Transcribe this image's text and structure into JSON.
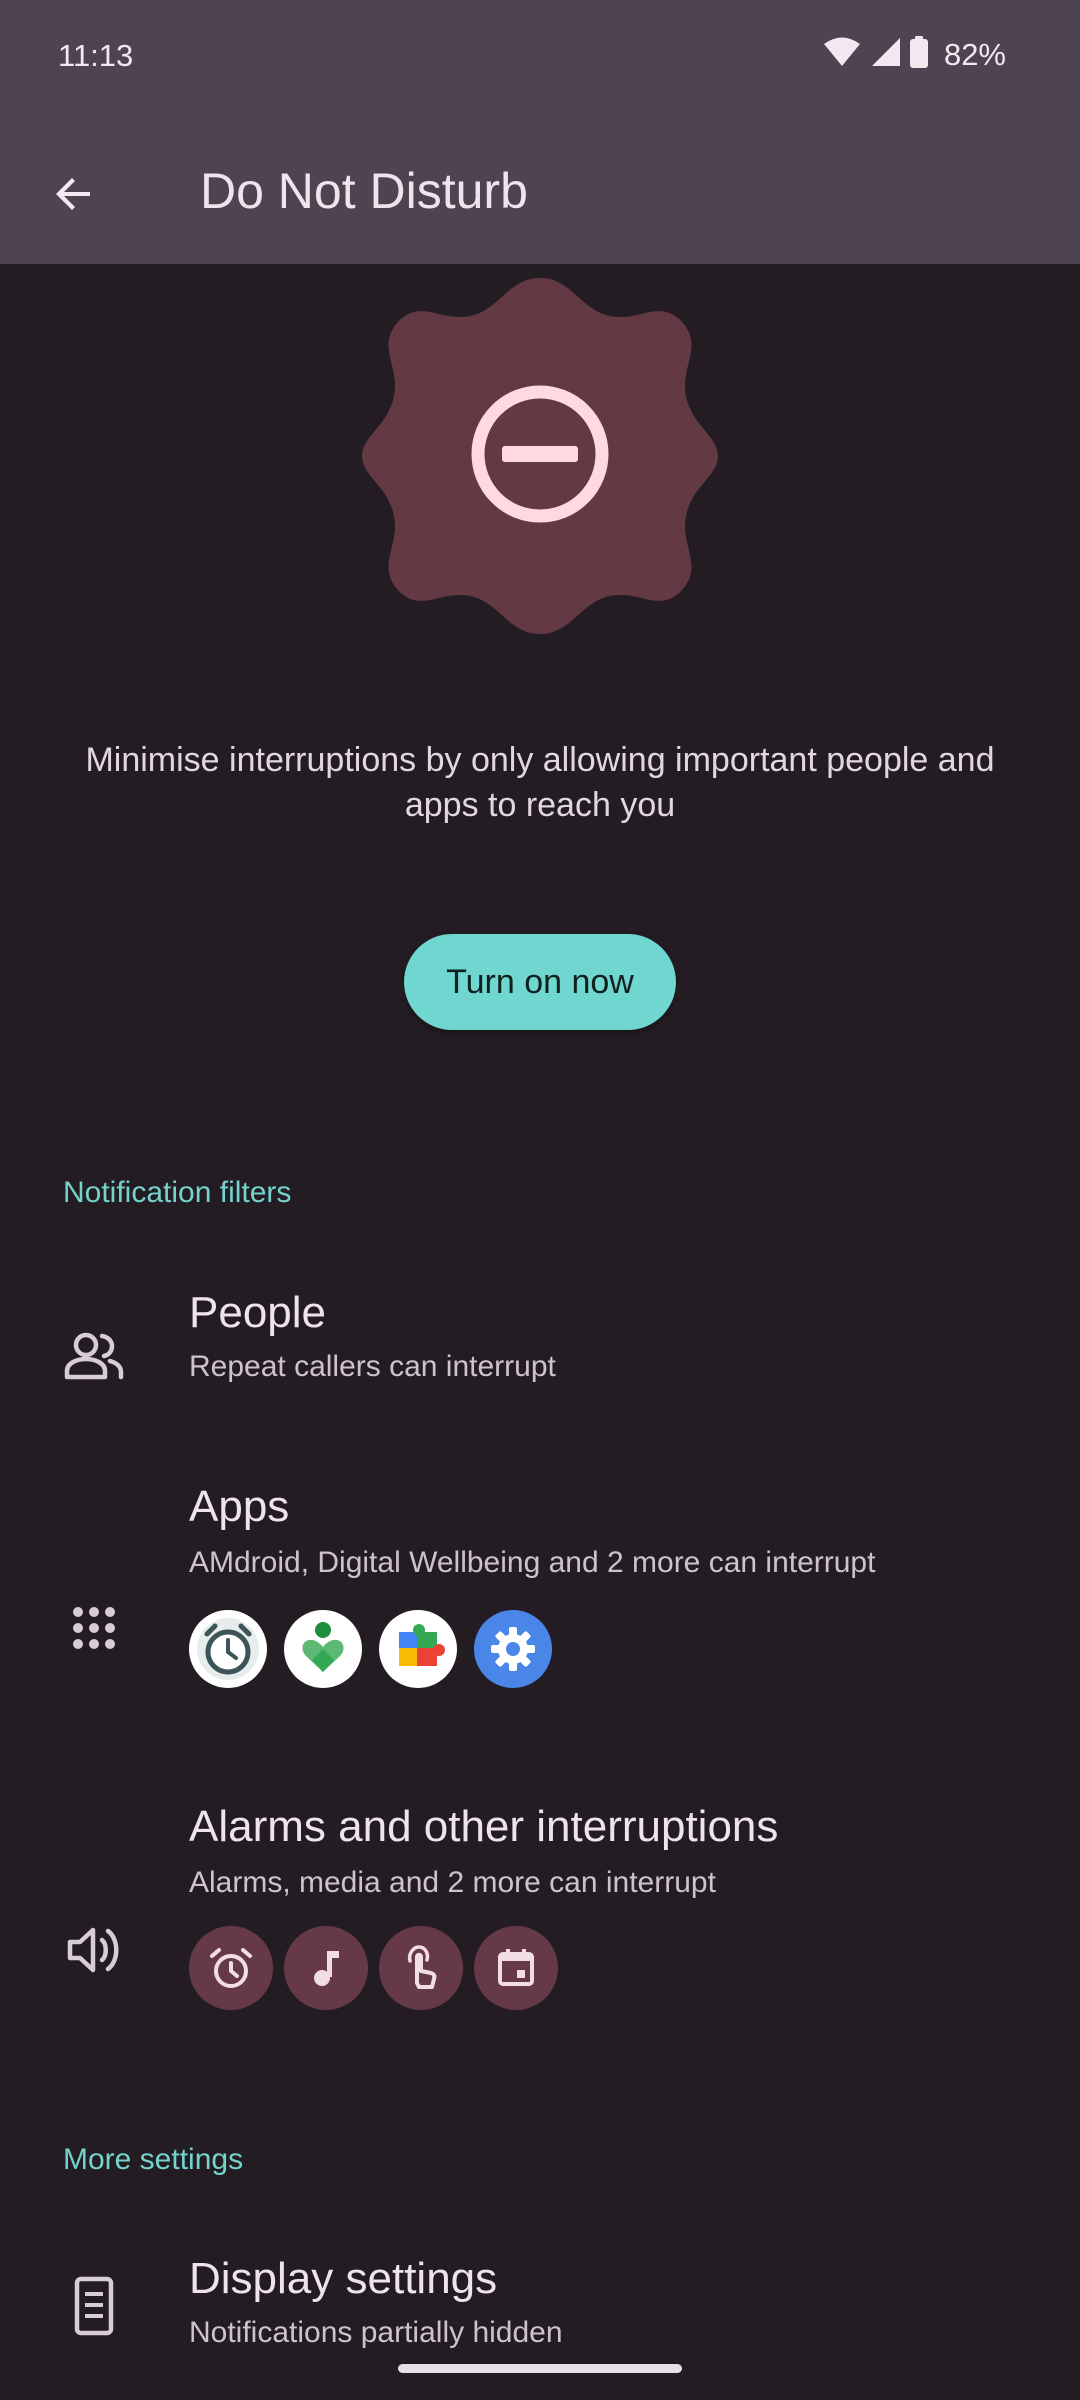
{
  "status_bar": {
    "time": "11:13",
    "battery": "82%",
    "icons": [
      "wifi-icon",
      "signal-icon",
      "battery-icon"
    ]
  },
  "app_bar": {
    "back_icon": "arrow-back-icon",
    "title": "Do Not Disturb"
  },
  "hero": {
    "icon": "do-not-disturb-icon",
    "description": "Minimise interruptions by only allowing important people and apps to reach you",
    "button_label": "Turn on now"
  },
  "notification_filters": {
    "header": "Notification filters",
    "people": {
      "icon": "people-icon",
      "title": "People",
      "subtitle": "Repeat callers can interrupt"
    },
    "apps": {
      "icon": "apps-grid-icon",
      "title": "Apps",
      "subtitle": "AMdroid, Digital Wellbeing and 2 more can interrupt",
      "app_icons": [
        "amdroid-app-icon",
        "digital-wellbeing-app-icon",
        "google-play-services-app-icon",
        "settings-app-icon"
      ]
    },
    "alarms": {
      "icon": "volume-icon",
      "title": "Alarms and other interruptions",
      "subtitle": "Alarms, media and 2 more can interrupt",
      "category_icons": [
        "alarm-icon",
        "music-note-icon",
        "touch-icon",
        "event-icon"
      ]
    }
  },
  "more_settings": {
    "header": "More settings",
    "display": {
      "icon": "display-icon",
      "title": "Display settings",
      "subtitle": "Notifications partially hidden"
    }
  },
  "colors": {
    "background": "#231d23",
    "app_bar": "#4d4351",
    "accent": "#6fd6d0",
    "section_header": "#74d3cc",
    "badge": "#633943",
    "badge_icon": "#ffd9e2",
    "chip": "#653a46"
  }
}
